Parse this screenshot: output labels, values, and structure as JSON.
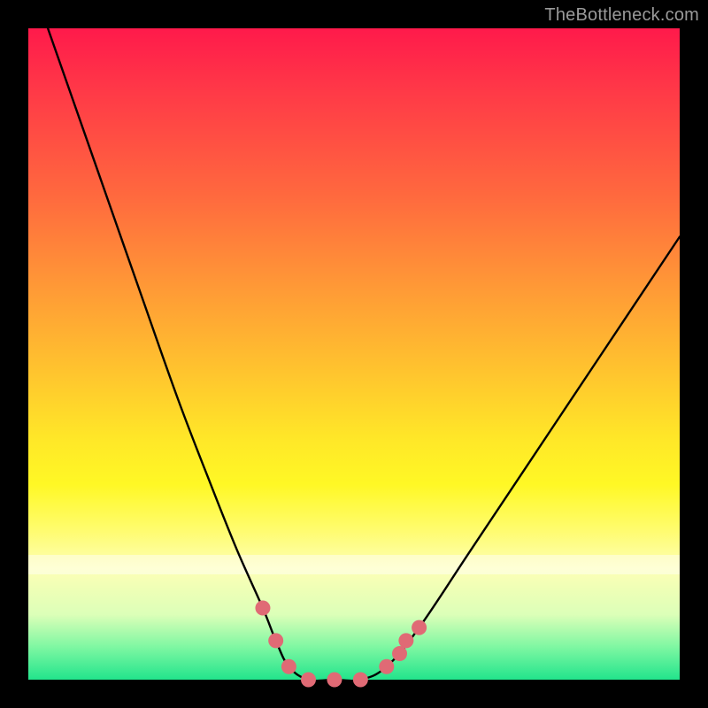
{
  "watermark": "TheBottleneck.com",
  "chart_data": {
    "type": "line",
    "title": "",
    "xlabel": "",
    "ylabel": "",
    "xlim": [
      0,
      100
    ],
    "ylim": [
      0,
      100
    ],
    "series": [
      {
        "name": "bottleneck-curve",
        "x": [
          3,
          10,
          17,
          23,
          28,
          32,
          36,
          38,
          40,
          43,
          47,
          51,
          55,
          60,
          68,
          78,
          88,
          100
        ],
        "values": [
          100,
          80,
          60,
          43,
          30,
          20,
          11,
          6,
          2,
          0,
          0,
          0,
          2,
          8,
          20,
          35,
          50,
          68
        ]
      }
    ],
    "markers": {
      "name": "optimal-range-markers",
      "color": "#e06a75",
      "x": [
        36,
        38,
        40,
        43,
        47,
        51,
        55,
        57,
        58,
        60
      ],
      "values": [
        11,
        6,
        2,
        0,
        0,
        0,
        2,
        4,
        6,
        8
      ]
    },
    "background_gradient": {
      "top": "#ff1a4b",
      "mid": "#ffe728",
      "bottom": "#22e48c"
    }
  }
}
